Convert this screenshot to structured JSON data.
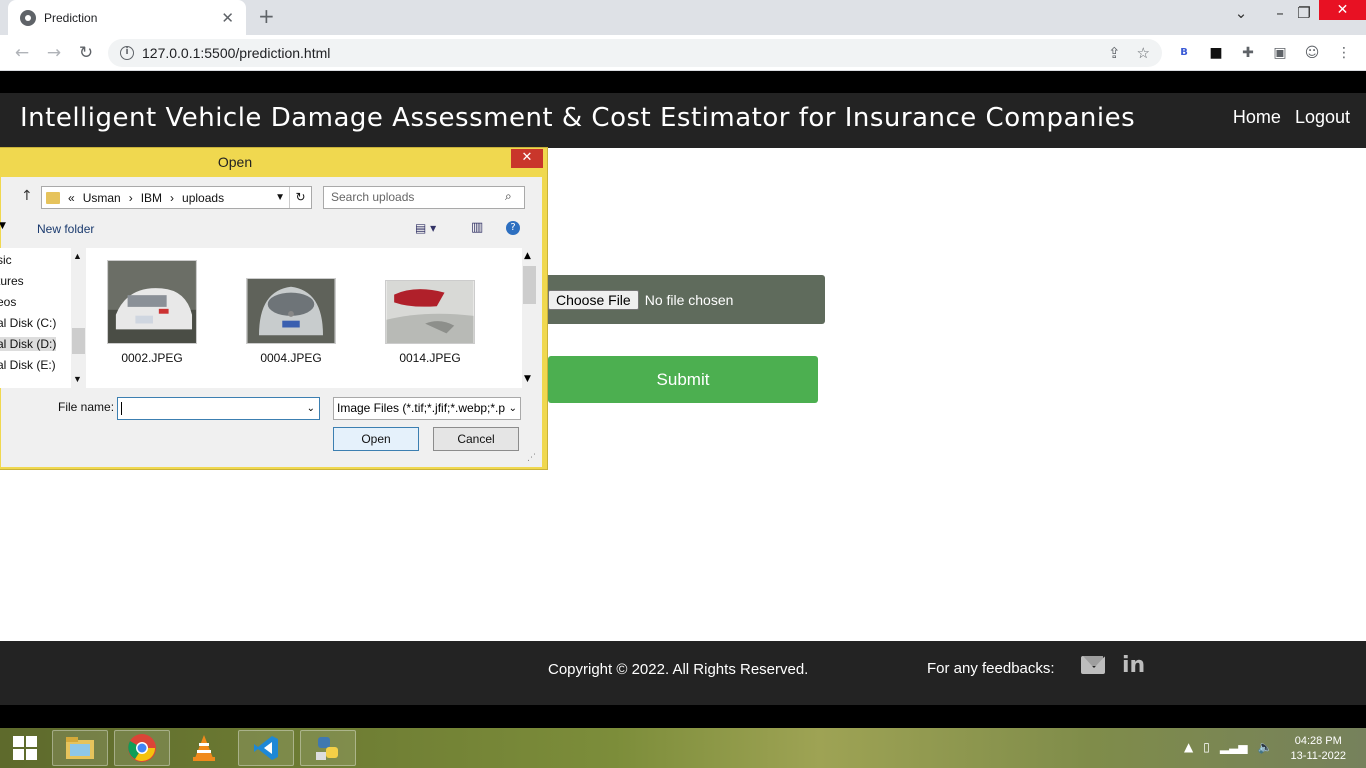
{
  "browser": {
    "tab_title": "Prediction",
    "url": "127.0.0.1:5500/prediction.html"
  },
  "site": {
    "title": "Intelligent Vehicle Damage Assessment & Cost Estimator for Insurance Companies",
    "nav": [
      "Home",
      "Logout"
    ],
    "choose_file_label": "Choose File",
    "no_file_text": "No file chosen",
    "submit_label": "Submit",
    "copyright": "Copyright © 2022. All Rights Reserved.",
    "feedback_label": "For any feedbacks:",
    "linkedin_text": "in"
  },
  "dialog": {
    "title": "Open",
    "breadcrumb": [
      "«",
      "Usman",
      "›",
      "IBM",
      "›",
      "uploads"
    ],
    "search_placeholder": "Search uploads",
    "new_folder": "New folder",
    "nav_items": [
      "sic",
      "tures",
      "eos",
      "al Disk (C:)",
      "al Disk (D:)",
      "al Disk (E:)"
    ],
    "files": [
      "0002.JPEG",
      "0004.JPEG",
      "0014.JPEG"
    ],
    "file_name_label": "File name:",
    "file_name_value": "",
    "filter_value": "Image Files (*.tif;*.jfif;*.webp;*.p",
    "open_label": "Open",
    "cancel_label": "Cancel"
  },
  "taskbar": {
    "time": "04:28 PM",
    "date": "13-11-2022"
  },
  "colors": {
    "header_bg": "#232323",
    "submit_bg": "#4caf50",
    "filebox_bg": "#5f6b5c",
    "dialog_frame": "#f0d84f"
  }
}
